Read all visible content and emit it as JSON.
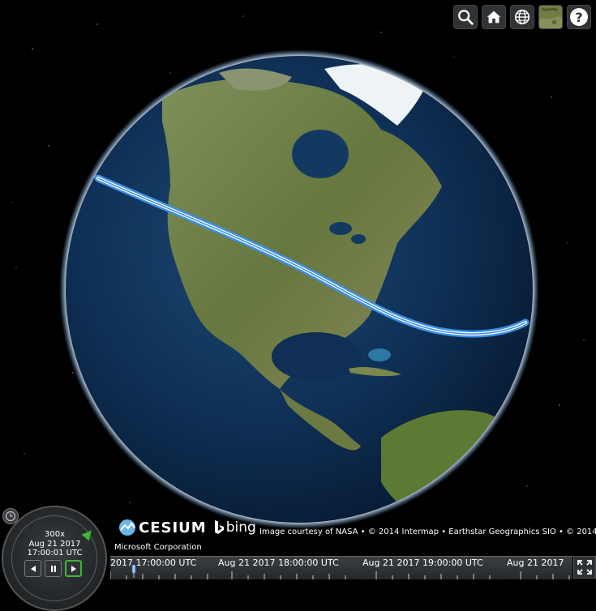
{
  "toolbar": {
    "search": {
      "icon": "search-icon"
    },
    "home": {
      "icon": "home-icon"
    },
    "scene_mode": {
      "icon": "globe-icon"
    },
    "base_layer": {
      "icon": "imagery-thumbnail-icon"
    },
    "help": {
      "label": "?"
    }
  },
  "credits": {
    "cesium_label": "CESIUM",
    "bing_label": "bing",
    "attribution": "Image courtesy of NASA • © 2014 Intermap • Earthstar Geographics SIO • © 2014",
    "provider": "Microsoft Corporation"
  },
  "animation": {
    "speed": "300x",
    "date": "Aug 21 2017",
    "time": "17:00:01 UTC"
  },
  "timeline": {
    "labels": [
      "2017 17:00:00 UTC",
      "Aug 21 2017 18:00:00 UTC",
      "Aug 21 2017 19:00:00 UTC",
      "Aug 21 2017"
    ]
  },
  "colors": {
    "path": "#3c8fe8",
    "ocean": "#0c2a4a",
    "land": "#6f7f49",
    "accent_green": "#3fb539"
  }
}
